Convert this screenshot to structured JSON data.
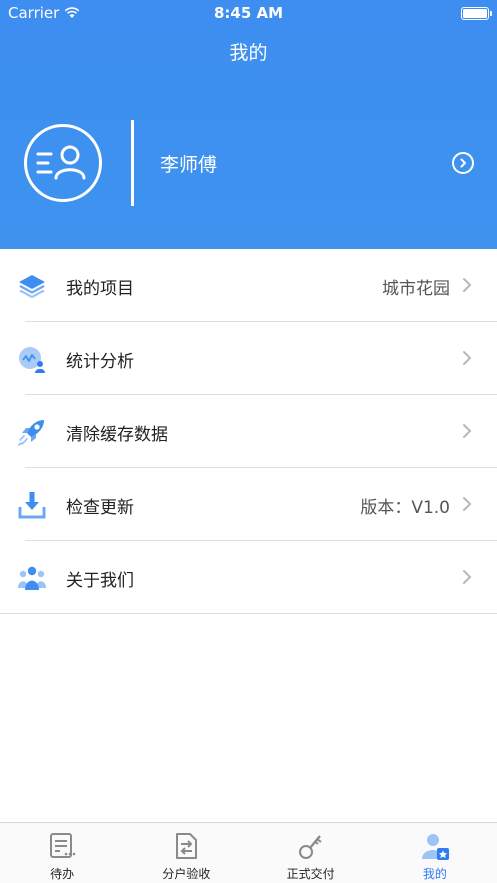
{
  "status_bar": {
    "carrier": "Carrier",
    "time": "8:45 AM"
  },
  "header": {
    "title": "我的"
  },
  "profile": {
    "name": "李师傅"
  },
  "menu": [
    {
      "label": "我的项目",
      "value": "城市花园",
      "icon": "layers-icon"
    },
    {
      "label": "统计分析",
      "value": "",
      "icon": "chart-user-icon"
    },
    {
      "label": "清除缓存数据",
      "value": "",
      "icon": "rocket-icon"
    },
    {
      "label": "检查更新",
      "value": "版本：V1.0",
      "icon": "download-icon"
    },
    {
      "label": "关于我们",
      "value": "",
      "icon": "team-icon"
    }
  ],
  "tabbar": [
    {
      "label": "待办",
      "icon": "todo-list-icon",
      "active": false
    },
    {
      "label": "分户验收",
      "icon": "transfer-doc-icon",
      "active": false
    },
    {
      "label": "正式交付",
      "icon": "key-icon",
      "active": false
    },
    {
      "label": "我的",
      "icon": "profile-icon",
      "active": true
    }
  ],
  "colors": {
    "primary": "#3d8ef0",
    "active_tab": "#2f7cf0"
  }
}
